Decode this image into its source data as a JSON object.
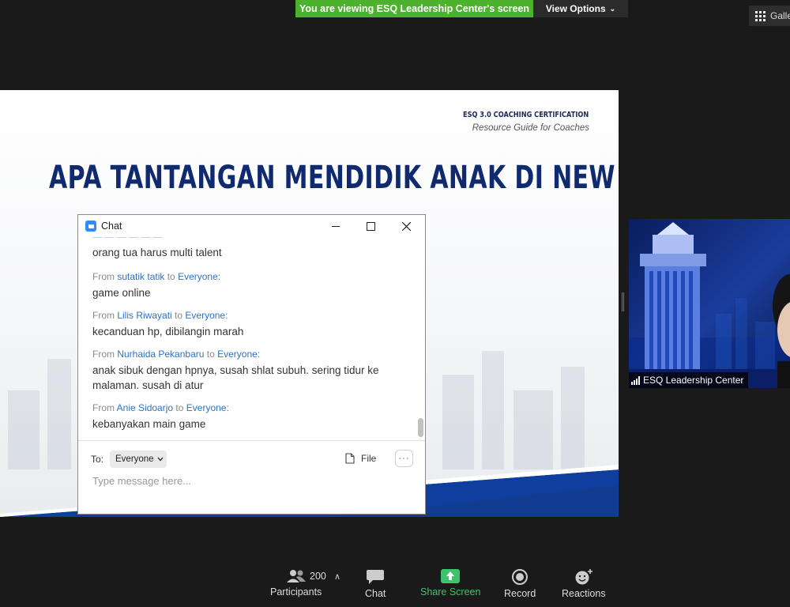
{
  "banner": {
    "viewing_text": "You are viewing ESQ Leadership Center's screen",
    "view_options": "View Options",
    "gallery_label": "Galle"
  },
  "slide": {
    "header_line1": "ESQ 3.0 COACHING CERTIFICATION",
    "header_line2": "Resource Guide for Coaches",
    "title": "APA TANTANGAN MENDIDIK ANAK DI NEW NORMAL"
  },
  "chat": {
    "title": "Chat",
    "first_message_text": "orang tua harus multi talent",
    "from_word": "From",
    "to_word": "to",
    "messages": [
      {
        "sender": "sutatik tatik",
        "recipient": "Everyone:",
        "text": "game online"
      },
      {
        "sender": "Lilis Riwayati",
        "recipient": "Everyone:",
        "text": "kecanduan hp, dibilangin marah"
      },
      {
        "sender": "Nurhaida Pekanbaru",
        "recipient": "Everyone:",
        "text": "anak sibuk dengan hpnya, susah shlat subuh. sering tidur ke malaman. susah di atur"
      },
      {
        "sender": "Anie Sidoarjo",
        "recipient": "Everyone:",
        "text": "kebanyakan main game"
      }
    ],
    "to_label": "To:",
    "to_value": "Everyone",
    "file_label": "File",
    "more_label": "···",
    "input_placeholder": "Type message here..."
  },
  "video": {
    "name": "ESQ Leadership Center"
  },
  "toolbar": {
    "participants_label": "Participants",
    "participants_count": "200",
    "chat_label": "Chat",
    "share_label": "Share Screen",
    "record_label": "Record",
    "reactions_label": "Reactions"
  },
  "colors": {
    "banner_green": "#4cb12c",
    "share_green": "#3cc36b",
    "link_blue": "#2d72c4",
    "slide_navy": "#0f2a6e"
  }
}
